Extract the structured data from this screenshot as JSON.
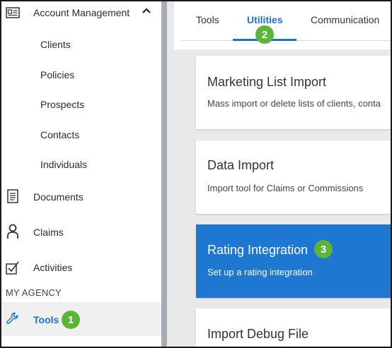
{
  "sidebar": {
    "account_management": "Account Management",
    "sub_items": [
      "Clients",
      "Policies",
      "Prospects",
      "Contacts",
      "Individuals"
    ],
    "documents": "Documents",
    "claims": "Claims",
    "activities": "Activities",
    "section_my_agency": "MY AGENCY",
    "tools": "Tools",
    "tools_badge": "1"
  },
  "tabs": {
    "items": [
      "Tools",
      "Utilities",
      "Communication"
    ],
    "active": "Utilities",
    "badge": "2"
  },
  "cards": [
    {
      "title": "Marketing List Import",
      "desc": "Mass import or delete lists of clients, conta"
    },
    {
      "title": "Data Import",
      "desc": "Import tool for Claims or Commissions"
    },
    {
      "title": "Rating Integration",
      "desc": "Set up a rating integration",
      "badge": "3"
    },
    {
      "title": "Import Debug File",
      "desc": ""
    }
  ],
  "colors": {
    "accent": "#1a73c8",
    "highlight_card": "#1e78d2",
    "badge_green": "#5bb536"
  },
  "icons": {
    "account_management": "contact-card-icon",
    "chevron": "chevron-up-icon",
    "documents": "document-icon",
    "claims": "person-icon",
    "activities": "checkbox-icon",
    "tools": "wrench-icon"
  }
}
